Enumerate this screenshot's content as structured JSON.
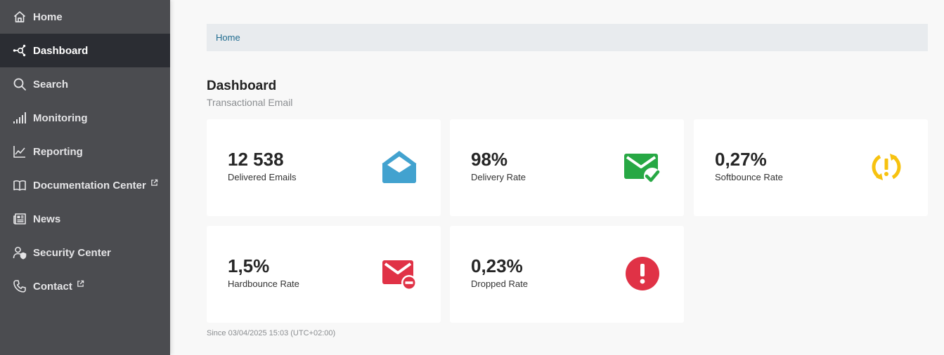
{
  "sidebar": {
    "items": [
      {
        "label": "Home",
        "icon": "home-icon",
        "active": false
      },
      {
        "label": "Dashboard",
        "icon": "dashboard-icon",
        "active": true
      },
      {
        "label": "Search",
        "icon": "search-icon",
        "active": false
      },
      {
        "label": "Monitoring",
        "icon": "signal-bars-icon",
        "active": false
      },
      {
        "label": "Reporting",
        "icon": "line-chart-icon",
        "active": false
      },
      {
        "label": "Documentation Center",
        "icon": "book-icon",
        "active": false,
        "external": true
      },
      {
        "label": "News",
        "icon": "newspaper-icon",
        "active": false
      },
      {
        "label": "Security Center",
        "icon": "user-shield-icon",
        "active": false
      },
      {
        "label": "Contact",
        "icon": "phone-icon",
        "active": false,
        "external": true
      }
    ]
  },
  "breadcrumb": {
    "home": "Home"
  },
  "header": {
    "title": "Dashboard",
    "subtitle": "Transactional Email"
  },
  "cards": [
    {
      "value": "12 538",
      "label": "Delivered Emails",
      "icon": "envelope-open-icon",
      "color": "#42a2cf"
    },
    {
      "value": "98%",
      "label": "Delivery Rate",
      "icon": "envelope-check-icon",
      "color": "#27a844"
    },
    {
      "value": "0,27%",
      "label": "Softbounce Rate",
      "icon": "sync-alert-icon",
      "color": "#f7c20f"
    },
    {
      "value": "1,5%",
      "label": "Hardbounce Rate",
      "icon": "envelope-minus-icon",
      "color": "#e03246"
    },
    {
      "value": "0,23%",
      "label": "Dropped Rate",
      "icon": "exclamation-circle-icon",
      "color": "#e03246"
    }
  ],
  "footer": {
    "since": "Since 03/04/2025 15:03 (UTC+02:00)"
  }
}
